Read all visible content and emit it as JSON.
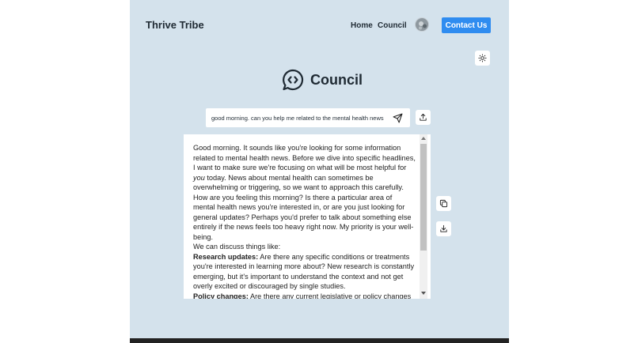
{
  "header": {
    "brand": "Thrive Tribe",
    "nav": [
      {
        "label": "Home"
      },
      {
        "label": "Council"
      }
    ],
    "contact_label": "Contact Us"
  },
  "page": {
    "title": "Council",
    "icon": "chat-code-icon"
  },
  "query": {
    "value": "good morning. can you help me related to the mental health news"
  },
  "response": {
    "intro": "Good morning. It sounds like you're looking for some information related to mental health news. Before we dive into specific headlines, I want to make sure we're focusing on what will be most helpful for ",
    "intro_em": "you",
    "intro_end": " today. News about mental health can sometimes be overwhelming or triggering, so we want to approach this carefully.",
    "para2": "How are you feeling this morning? Is there a particular area of mental health news you're interested in, or are you just looking for general updates? Perhaps you'd prefer to talk about something else entirely if the news feels too heavy right now. My priority is your well-being.",
    "para3": "We can discuss things like:",
    "item1_label": "Research updates:",
    "item1_text": " Are there any specific conditions or treatments you're interested in learning more about? New research is constantly emerging, but it's important to understand the context and not get overly excited or discouraged by single studies.",
    "item2_label": "Policy changes:",
    "item2_text": " Are there any current legislative or policy changes related to mental health access or funding that you'd like to discuss?"
  },
  "colors": {
    "background": "#d4e2ec",
    "accent": "#2f8cf0"
  },
  "icons": [
    "sun-icon",
    "send-icon",
    "upload-icon",
    "copy-icon",
    "download-icon",
    "avatar"
  ]
}
